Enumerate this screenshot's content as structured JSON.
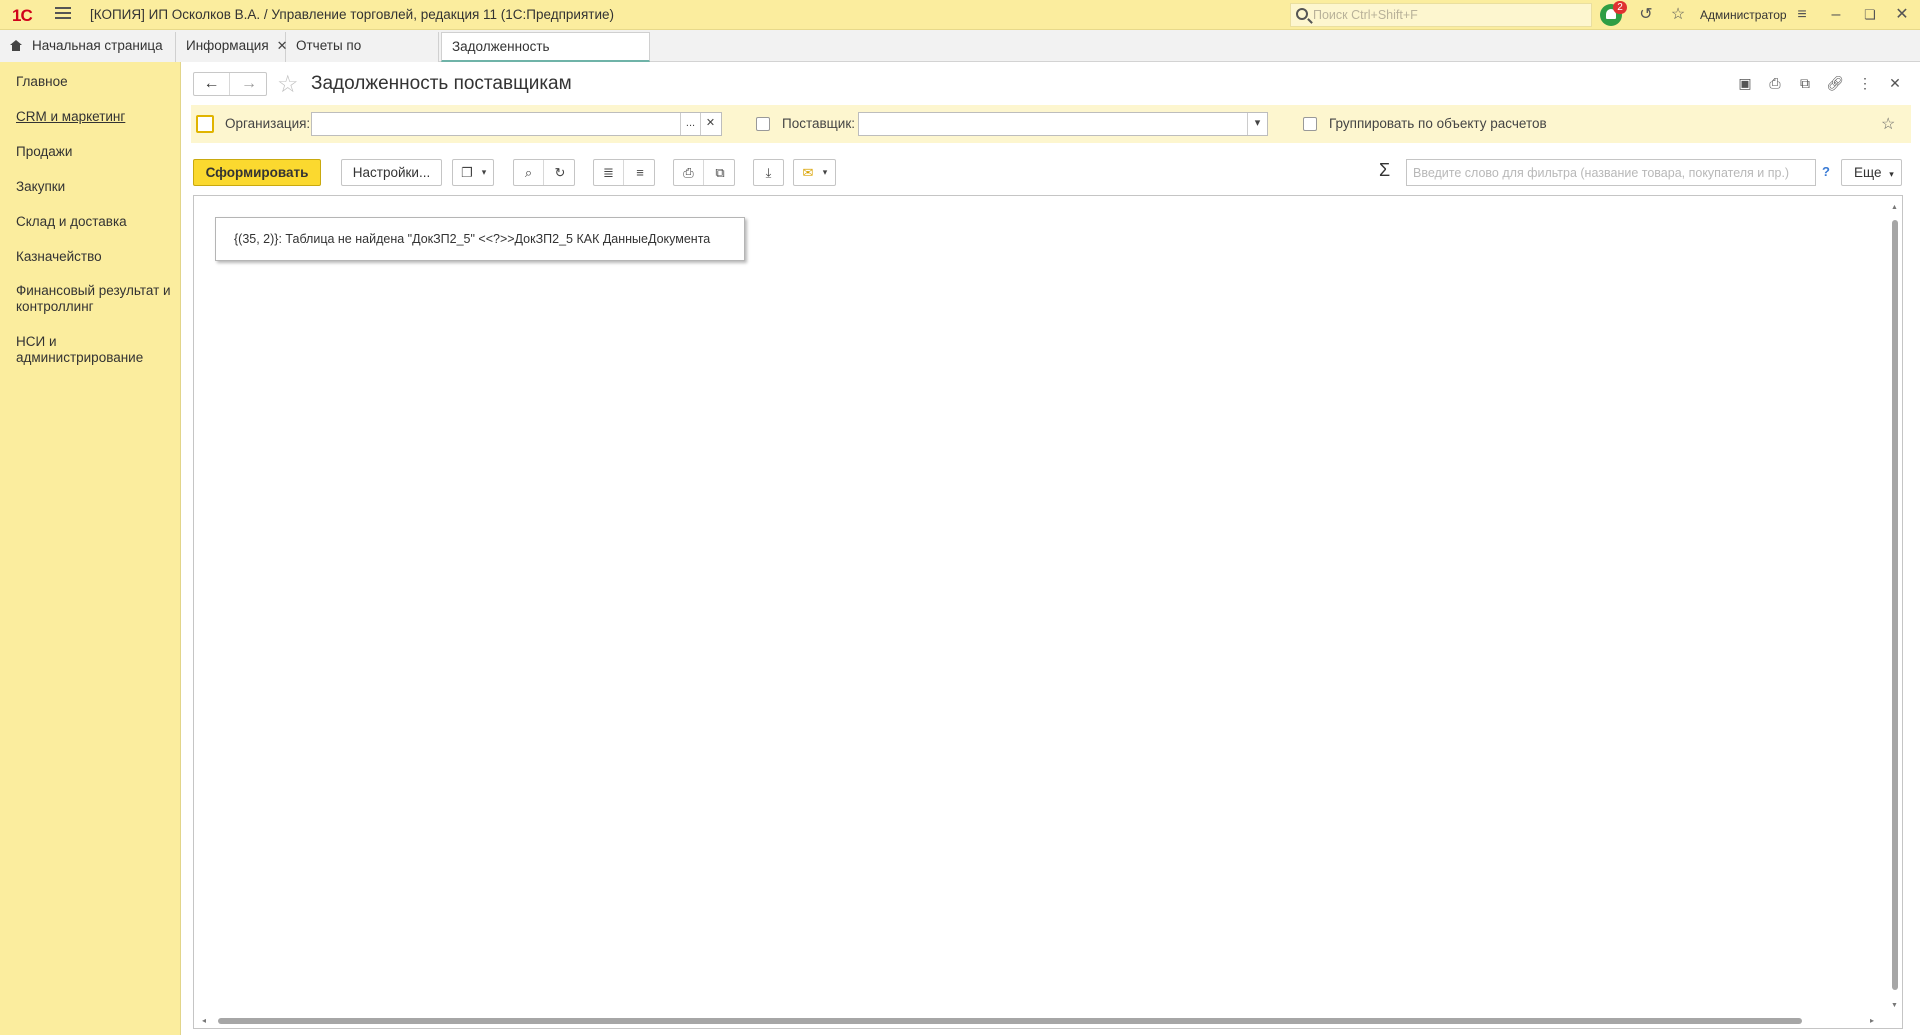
{
  "app": {
    "logo": "1С",
    "title": "[КОПИЯ] ИП Осколков В.А. / Управление торговлей, редакция 11  (1С:Предприятие)",
    "search_placeholder": "Поиск Ctrl+Shift+F",
    "notifications_count": "2",
    "user": "Администратор"
  },
  "tabs": [
    {
      "label": "Начальная страница"
    },
    {
      "label": "Информация"
    },
    {
      "label": "Отчеты по закупкам"
    },
    {
      "label": "Задолженность поставщикам"
    }
  ],
  "sidebar": {
    "items": [
      {
        "label": "Главное"
      },
      {
        "label": "CRM и маркетинг"
      },
      {
        "label": "Продажи"
      },
      {
        "label": "Закупки"
      },
      {
        "label": "Склад и доставка"
      },
      {
        "label": "Казначейство"
      },
      {
        "label": "Финансовый результат и контроллинг"
      },
      {
        "label": "НСИ и администрирование"
      }
    ]
  },
  "page": {
    "title": "Задолженность поставщикам"
  },
  "filters": {
    "organization_label": "Организация:",
    "organization_value": "",
    "supplier_label": "Поставщик:",
    "supplier_value": "",
    "group_label": "Группировать по объекту расчетов"
  },
  "toolbar": {
    "generate": "Сформировать",
    "settings": "Настройки...",
    "filter_placeholder": "Введите слово для фильтра (название товара, покупателя и пр.)",
    "help": "?",
    "more": "Еще"
  },
  "report": {
    "error": "{(35, 2)}: Таблица не найдена \"ДокЗП2_5\" <<?>>ДокЗП2_5 КАК ДанныеДокумента"
  }
}
